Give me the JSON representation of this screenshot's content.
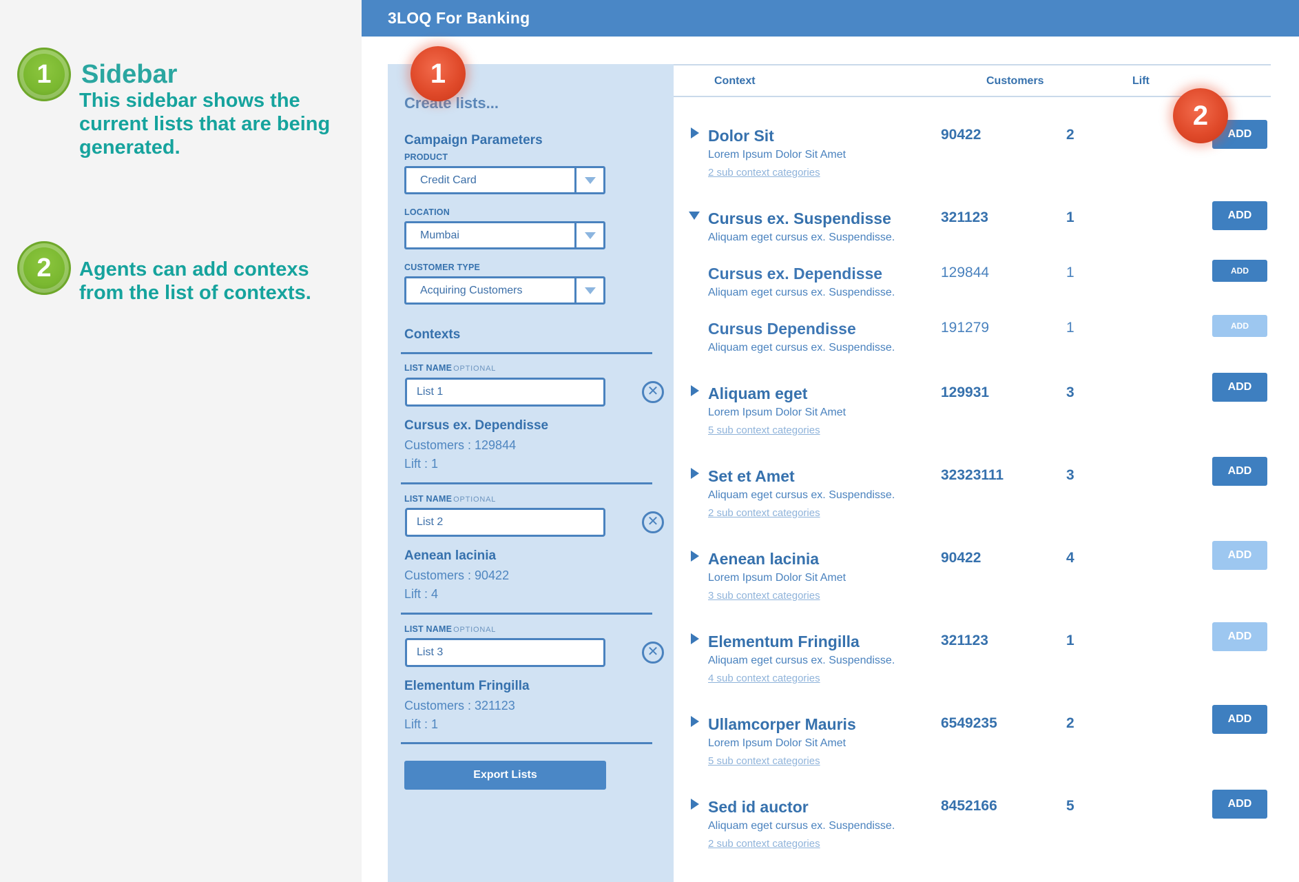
{
  "annotations": [
    {
      "number": "1",
      "title": "Sidebar",
      "text": "This sidebar shows the current lists that are being generated."
    },
    {
      "number": "2",
      "title": "",
      "text": "Agents can add contexs from the list of contexts."
    }
  ],
  "app": {
    "title": "3LOQ For Banking"
  },
  "sidebar": {
    "create_label": "Create lists...",
    "campaign_title": "Campaign Parameters",
    "product_label": "PRODUCT",
    "product_value": "Credit Card",
    "location_label": "LOCATION",
    "location_value": "Mumbai",
    "customer_type_label": "CUSTOMER TYPE",
    "customer_type_value": "Acquiring Customers",
    "contexts_title": "Contexts",
    "list_name_label": "LIST NAME",
    "optional_label": "OPTIONAL",
    "remove_icon": "close-circle-icon",
    "lists": [
      {
        "name": "List 1",
        "context": "Cursus ex. Dependisse",
        "customers": "Customers : 129844",
        "lift": "Lift : 1"
      },
      {
        "name": "List 2",
        "context": "Aenean lacinia",
        "customers": "Customers : 90422",
        "lift": "Lift : 4"
      },
      {
        "name": "List 3",
        "context": "Elementum Fringilla",
        "customers": "Customers : 321123",
        "lift": "Lift : 1"
      }
    ],
    "export_label": "Export Lists"
  },
  "table": {
    "headers": {
      "context": "Context",
      "customers": "Customers",
      "lift": "Lift"
    },
    "rows": [
      {
        "name": "Dolor Sit",
        "desc": "Lorem Ipsum Dolor Sit Amet",
        "sub": "2 sub context categories",
        "customers": "90422",
        "lift": "2",
        "toggle": "expand-arrow-icon",
        "add": "ADD",
        "add_state": "enabled"
      },
      {
        "name": "Cursus ex. Suspendisse",
        "desc": "Aliquam eget cursus ex. Suspendisse.",
        "sub": "",
        "customers": "321123",
        "lift": "1",
        "toggle": "collapse-arrow-icon",
        "add": "ADD",
        "add_state": "enabled"
      },
      {
        "name": "Cursus ex. Dependisse",
        "desc": "Aliquam eget cursus ex. Suspendisse.",
        "sub": "",
        "customers": "129844",
        "lift": "1",
        "toggle": "",
        "add": "ADD",
        "add_state": "enabled"
      },
      {
        "name": "Cursus Dependisse",
        "desc": "Aliquam eget cursus ex. Suspendisse.",
        "sub": "",
        "customers": "191279",
        "lift": "1",
        "toggle": "",
        "add": "ADD",
        "add_state": "disabled"
      },
      {
        "name": "Aliquam eget",
        "desc": "Lorem Ipsum Dolor Sit Amet",
        "sub": "5 sub context categories",
        "customers": "129931",
        "lift": "3",
        "toggle": "expand-arrow-icon",
        "add": "ADD",
        "add_state": "enabled"
      },
      {
        "name": "Set et Amet",
        "desc": "Aliquam eget cursus ex. Suspendisse.",
        "sub": "2 sub context categories",
        "customers": "32323111",
        "lift": "3",
        "toggle": "expand-arrow-icon",
        "add": "ADD",
        "add_state": "enabled"
      },
      {
        "name": "Aenean lacinia",
        "desc": "Lorem Ipsum Dolor Sit Amet",
        "sub": "3 sub context categories",
        "customers": "90422",
        "lift": "4",
        "toggle": "expand-arrow-icon",
        "add": "ADD",
        "add_state": "disabled"
      },
      {
        "name": "Elementum Fringilla",
        "desc": "Aliquam eget cursus ex. Suspendisse.",
        "sub": "4 sub context categories",
        "customers": "321123",
        "lift": "1",
        "toggle": "expand-arrow-icon",
        "add": "ADD",
        "add_state": "disabled"
      },
      {
        "name": "Ullamcorper Mauris",
        "desc": "Lorem Ipsum Dolor Sit Amet",
        "sub": "5 sub context categories",
        "customers": "6549235",
        "lift": "2",
        "toggle": "expand-arrow-icon",
        "add": "ADD",
        "add_state": "enabled"
      },
      {
        "name": "Sed id auctor",
        "desc": "Aliquam eget cursus ex. Suspendisse.",
        "sub": "2 sub context categories",
        "customers": "8452166",
        "lift": "5",
        "toggle": "expand-arrow-icon",
        "add": "ADD",
        "add_state": "enabled"
      }
    ]
  },
  "callouts": [
    "1",
    "2"
  ],
  "colors": {
    "header": "#4a87c6",
    "sidebar_bg": "#d1e2f3",
    "primary_text": "#3671ad",
    "add_enabled": "#3e7fc0",
    "add_disabled": "#9dc7f0",
    "annotation_green": "#7ab830",
    "annotation_teal": "#16a39d",
    "callout_red": "#e04a2a"
  }
}
